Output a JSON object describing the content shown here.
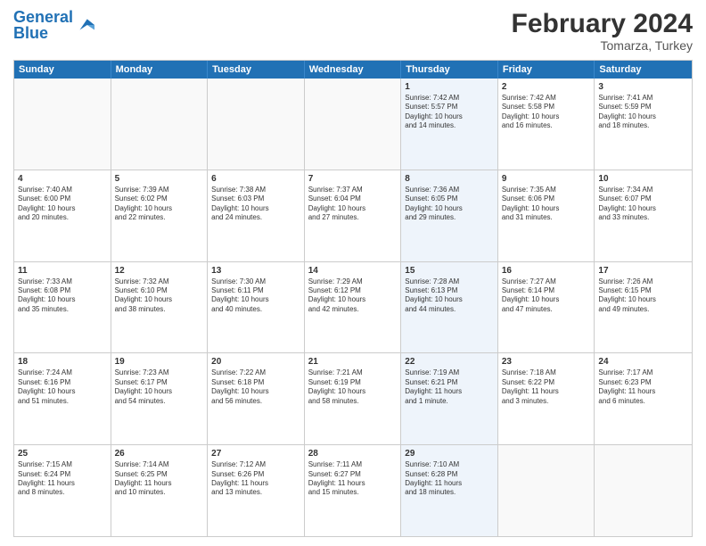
{
  "header": {
    "logo": {
      "text_general": "General",
      "text_blue": "Blue"
    },
    "title": "February 2024",
    "subtitle": "Tomarza, Turkey"
  },
  "days_of_week": [
    "Sunday",
    "Monday",
    "Tuesday",
    "Wednesday",
    "Thursday",
    "Friday",
    "Saturday"
  ],
  "weeks": [
    [
      {
        "day": "",
        "info": ""
      },
      {
        "day": "",
        "info": ""
      },
      {
        "day": "",
        "info": ""
      },
      {
        "day": "",
        "info": ""
      },
      {
        "day": "1",
        "info": "Sunrise: 7:42 AM\nSunset: 5:57 PM\nDaylight: 10 hours\nand 14 minutes."
      },
      {
        "day": "2",
        "info": "Sunrise: 7:42 AM\nSunset: 5:58 PM\nDaylight: 10 hours\nand 16 minutes."
      },
      {
        "day": "3",
        "info": "Sunrise: 7:41 AM\nSunset: 5:59 PM\nDaylight: 10 hours\nand 18 minutes."
      }
    ],
    [
      {
        "day": "4",
        "info": "Sunrise: 7:40 AM\nSunset: 6:00 PM\nDaylight: 10 hours\nand 20 minutes."
      },
      {
        "day": "5",
        "info": "Sunrise: 7:39 AM\nSunset: 6:02 PM\nDaylight: 10 hours\nand 22 minutes."
      },
      {
        "day": "6",
        "info": "Sunrise: 7:38 AM\nSunset: 6:03 PM\nDaylight: 10 hours\nand 24 minutes."
      },
      {
        "day": "7",
        "info": "Sunrise: 7:37 AM\nSunset: 6:04 PM\nDaylight: 10 hours\nand 27 minutes."
      },
      {
        "day": "8",
        "info": "Sunrise: 7:36 AM\nSunset: 6:05 PM\nDaylight: 10 hours\nand 29 minutes."
      },
      {
        "day": "9",
        "info": "Sunrise: 7:35 AM\nSunset: 6:06 PM\nDaylight: 10 hours\nand 31 minutes."
      },
      {
        "day": "10",
        "info": "Sunrise: 7:34 AM\nSunset: 6:07 PM\nDaylight: 10 hours\nand 33 minutes."
      }
    ],
    [
      {
        "day": "11",
        "info": "Sunrise: 7:33 AM\nSunset: 6:08 PM\nDaylight: 10 hours\nand 35 minutes."
      },
      {
        "day": "12",
        "info": "Sunrise: 7:32 AM\nSunset: 6:10 PM\nDaylight: 10 hours\nand 38 minutes."
      },
      {
        "day": "13",
        "info": "Sunrise: 7:30 AM\nSunset: 6:11 PM\nDaylight: 10 hours\nand 40 minutes."
      },
      {
        "day": "14",
        "info": "Sunrise: 7:29 AM\nSunset: 6:12 PM\nDaylight: 10 hours\nand 42 minutes."
      },
      {
        "day": "15",
        "info": "Sunrise: 7:28 AM\nSunset: 6:13 PM\nDaylight: 10 hours\nand 44 minutes."
      },
      {
        "day": "16",
        "info": "Sunrise: 7:27 AM\nSunset: 6:14 PM\nDaylight: 10 hours\nand 47 minutes."
      },
      {
        "day": "17",
        "info": "Sunrise: 7:26 AM\nSunset: 6:15 PM\nDaylight: 10 hours\nand 49 minutes."
      }
    ],
    [
      {
        "day": "18",
        "info": "Sunrise: 7:24 AM\nSunset: 6:16 PM\nDaylight: 10 hours\nand 51 minutes."
      },
      {
        "day": "19",
        "info": "Sunrise: 7:23 AM\nSunset: 6:17 PM\nDaylight: 10 hours\nand 54 minutes."
      },
      {
        "day": "20",
        "info": "Sunrise: 7:22 AM\nSunset: 6:18 PM\nDaylight: 10 hours\nand 56 minutes."
      },
      {
        "day": "21",
        "info": "Sunrise: 7:21 AM\nSunset: 6:19 PM\nDaylight: 10 hours\nand 58 minutes."
      },
      {
        "day": "22",
        "info": "Sunrise: 7:19 AM\nSunset: 6:21 PM\nDaylight: 11 hours\nand 1 minute."
      },
      {
        "day": "23",
        "info": "Sunrise: 7:18 AM\nSunset: 6:22 PM\nDaylight: 11 hours\nand 3 minutes."
      },
      {
        "day": "24",
        "info": "Sunrise: 7:17 AM\nSunset: 6:23 PM\nDaylight: 11 hours\nand 6 minutes."
      }
    ],
    [
      {
        "day": "25",
        "info": "Sunrise: 7:15 AM\nSunset: 6:24 PM\nDaylight: 11 hours\nand 8 minutes."
      },
      {
        "day": "26",
        "info": "Sunrise: 7:14 AM\nSunset: 6:25 PM\nDaylight: 11 hours\nand 10 minutes."
      },
      {
        "day": "27",
        "info": "Sunrise: 7:12 AM\nSunset: 6:26 PM\nDaylight: 11 hours\nand 13 minutes."
      },
      {
        "day": "28",
        "info": "Sunrise: 7:11 AM\nSunset: 6:27 PM\nDaylight: 11 hours\nand 15 minutes."
      },
      {
        "day": "29",
        "info": "Sunrise: 7:10 AM\nSunset: 6:28 PM\nDaylight: 11 hours\nand 18 minutes."
      },
      {
        "day": "",
        "info": ""
      },
      {
        "day": "",
        "info": ""
      }
    ]
  ]
}
